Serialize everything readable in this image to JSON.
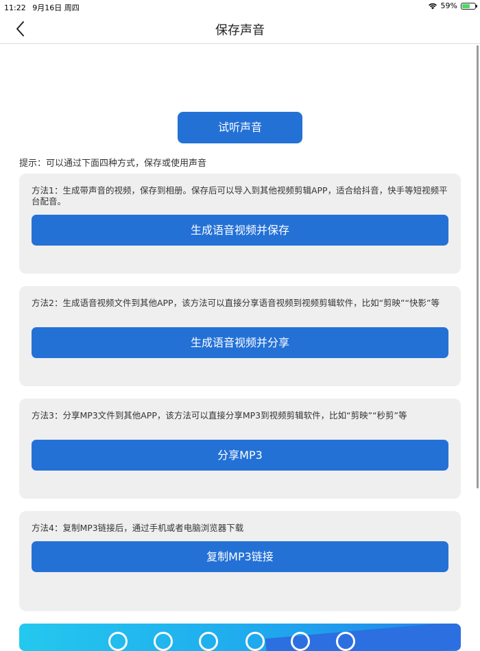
{
  "status_bar": {
    "time": "11:22",
    "date": "9月16日 周四",
    "battery_percent": "59%",
    "battery_level": 0.59,
    "icons": [
      "wifi-icon",
      "battery-icon"
    ]
  },
  "nav": {
    "title": "保存声音",
    "back_icon": "chevron-left-icon"
  },
  "listen_button_label": "试听声音",
  "hint": "提示：可以通过下面四种方式，保存或使用声音",
  "methods": [
    {
      "description": "方法1：生成带声音的视频，保存到相册。保存后可以导入到其他视频剪辑APP，适合给抖音，快手等短视频平台配音。",
      "button_label": "生成语音视频并保存"
    },
    {
      "description": "方法2：生成语音视频文件到其他APP，该方法可以直接分享语音视频到视频剪辑软件，比如“剪映”“快影”等",
      "button_label": "生成语音视频并分享"
    },
    {
      "description": "方法3：分享MP3文件到其他APP，该方法可以直接分享MP3到视频剪辑软件，比如“剪映”“秒剪”等",
      "button_label": "分享MP3"
    },
    {
      "description": "方法4：复制MP3链接后，通过手机或者电脑浏览器下载",
      "button_label": "复制MP3链接"
    }
  ],
  "colors": {
    "accent": "#2471d6",
    "card_bg": "#efefef",
    "banner_start": "#24c8ee",
    "banner_end": "#2382e8"
  }
}
